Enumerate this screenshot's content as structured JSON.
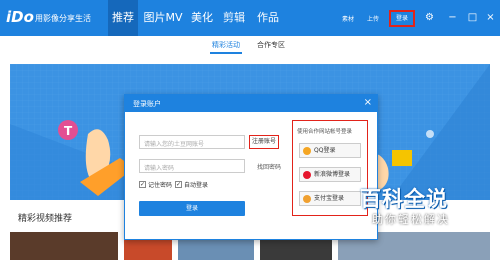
{
  "app": {
    "logo": "iDo",
    "slogan": "用影像分享生活"
  },
  "nav": {
    "tabs": [
      "推荐",
      "图片MV",
      "美化",
      "剪辑",
      "作品"
    ]
  },
  "top": {
    "vip": "素材",
    "upload": "上传",
    "login": "登录"
  },
  "subtabs": [
    "精彩活动",
    "合作专区"
  ],
  "section": {
    "title": "精彩视频推荐"
  },
  "dialog": {
    "title": "登录账户",
    "account_placeholder": "请输入您的土豆网账号",
    "register": "注册账号",
    "password_placeholder": "请输入密码",
    "forgot": "找回密码",
    "remember": "记住密码",
    "auto_login": "自动登录",
    "submit": "登录",
    "social_title": "使用合作网站帐号登录",
    "social": [
      "QQ登录",
      "新浪微博登录",
      "支付宝登录"
    ]
  },
  "colors": {
    "accent": "#1e82df",
    "highlight": "#e2231a"
  },
  "watermark": {
    "line1": "百科全说",
    "line2": "助你轻松解决"
  }
}
